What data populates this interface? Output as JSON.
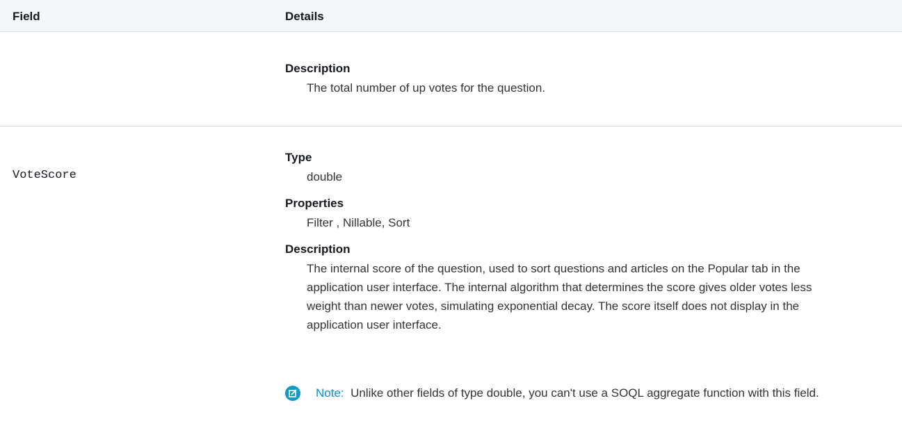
{
  "header": {
    "field_label": "Field",
    "details_label": "Details"
  },
  "rows": [
    {
      "field": "",
      "description_label": "Description",
      "description": "The total number of up votes for the question."
    },
    {
      "field": "VoteScore",
      "type_label": "Type",
      "type": "double",
      "properties_label": "Properties",
      "properties": "Filter , Nillable, Sort",
      "description_label": "Description",
      "description": "The internal score of the question, used to sort questions and articles on the Popular tab in the application user interface. The internal algorithm that determines the score gives older votes less weight than newer votes, simulating exponential decay. The score itself does not display in the application user interface.",
      "note": {
        "icon": "note-edit-icon",
        "label": "Note:",
        "text": "Unlike other fields of type double, you can't use a SOQL aggregate function with this field."
      }
    }
  ],
  "colors": {
    "header_bg": "#f4f6f9",
    "divider": "#d8dde6",
    "note_accent": "#0b8ed6"
  }
}
